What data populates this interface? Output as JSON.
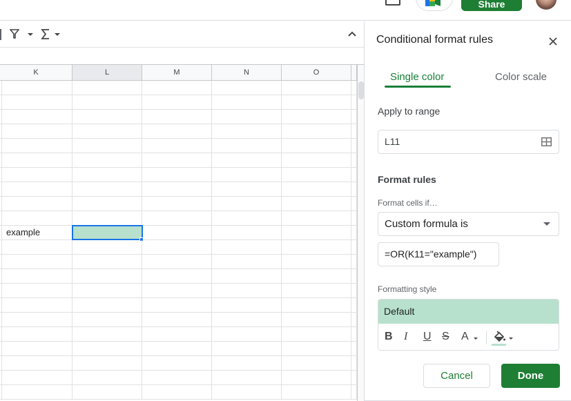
{
  "header": {
    "share_label": "Share",
    "comment_icon": "comment-icon",
    "meet_icon": "google-meet-icon",
    "avatar_icon": "user-avatar"
  },
  "toolbar": {
    "filter_icon": "filter-icon",
    "functions_icon": "sigma-functions-icon",
    "collapse_icon": "chevron-up-icon"
  },
  "sheet": {
    "columns": [
      "K",
      "L",
      "M",
      "N",
      "O"
    ],
    "selected_column": "L",
    "row_count_visible": 22,
    "cells": [
      {
        "row_index": 10,
        "col": "K",
        "value": "example"
      },
      {
        "row_index": 10,
        "col": "L",
        "value": "",
        "active": true,
        "fill": "#b7e1cd"
      }
    ]
  },
  "panel": {
    "title": "Conditional format rules",
    "tabs": [
      {
        "label": "Single color",
        "active": true
      },
      {
        "label": "Color scale",
        "active": false
      }
    ],
    "apply_to_range_label": "Apply to range",
    "range_value": "L11",
    "format_rules_label": "Format rules",
    "format_cells_if_label": "Format cells if…",
    "condition_value": "Custom formula is",
    "formula_value": "=OR(K11=\"example\")",
    "formatting_style_label": "Formatting style",
    "style_preview_label": "Default",
    "style_tools": {
      "bold": "B",
      "italic": "I",
      "underline": "U",
      "strikethrough": "S",
      "text_color": "A"
    },
    "fill_color": "#b7e1cd",
    "cancel_label": "Cancel",
    "done_label": "Done"
  },
  "colors": {
    "accent_green": "#188038",
    "button_green": "#1e7e34",
    "selection_blue": "#1a73e8",
    "highlight_fill": "#b7e1cd"
  }
}
